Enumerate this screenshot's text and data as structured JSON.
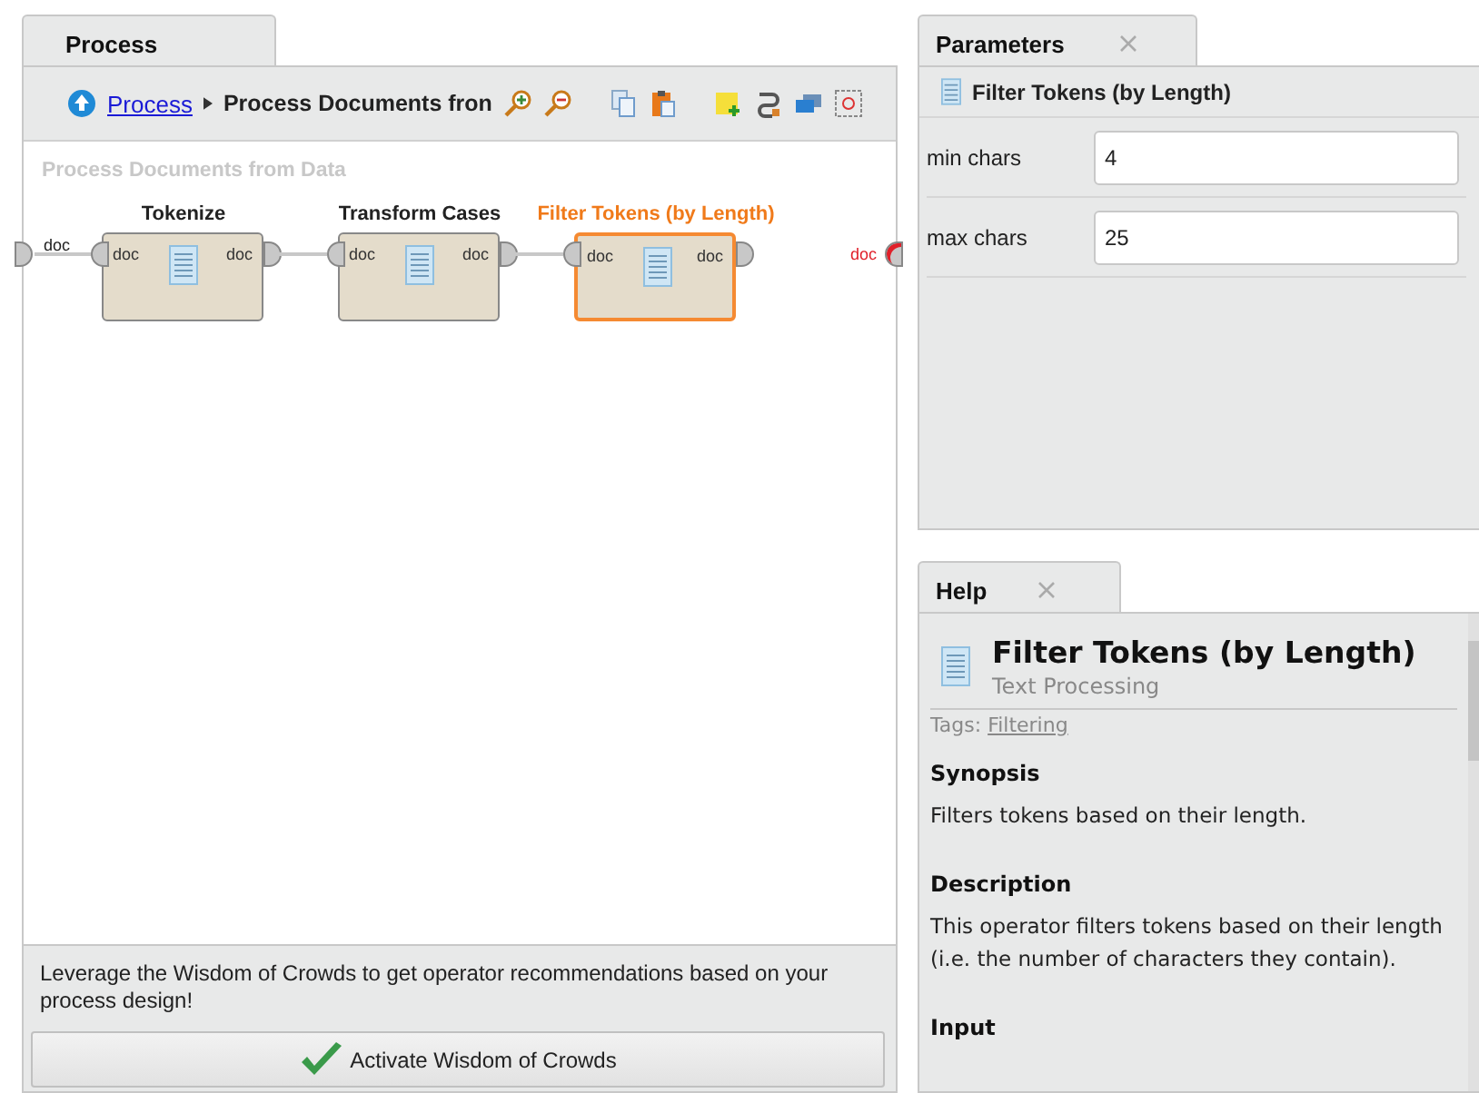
{
  "process_tab": {
    "label": "Process"
  },
  "breadcrumb": {
    "link": "Process",
    "current": "Process Documents fron"
  },
  "canvas": {
    "title": "Process Documents from Data",
    "input_port": "doc",
    "output_port": "doc",
    "operators": [
      {
        "name": "Tokenize",
        "in": "doc",
        "out": "doc",
        "selected": false
      },
      {
        "name": "Transform Cases",
        "in": "doc",
        "out": "doc",
        "selected": false
      },
      {
        "name": "Filter Tokens (by Length)",
        "in": "doc",
        "out": "doc",
        "selected": true
      }
    ]
  },
  "recommendation": {
    "text": "Leverage the Wisdom of Crowds to get operator recommendations based on your process design!",
    "button": "Activate Wisdom of Crowds"
  },
  "parameters": {
    "tab": "Parameters",
    "operator": "Filter Tokens (by Length)",
    "rows": [
      {
        "label": "min chars",
        "value": "4"
      },
      {
        "label": "max chars",
        "value": "25"
      }
    ]
  },
  "help": {
    "tab": "Help",
    "title": "Filter Tokens (by Length)",
    "subtitle": "Text Processing",
    "tags_label": "Tags:",
    "tag": "Filtering",
    "sections": [
      {
        "heading": "Synopsis",
        "text": "Filters tokens based on their length."
      },
      {
        "heading": "Description",
        "text": "This operator filters tokens based on their length (i.e. the number of characters they contain)."
      },
      {
        "heading": "Input"
      }
    ]
  }
}
